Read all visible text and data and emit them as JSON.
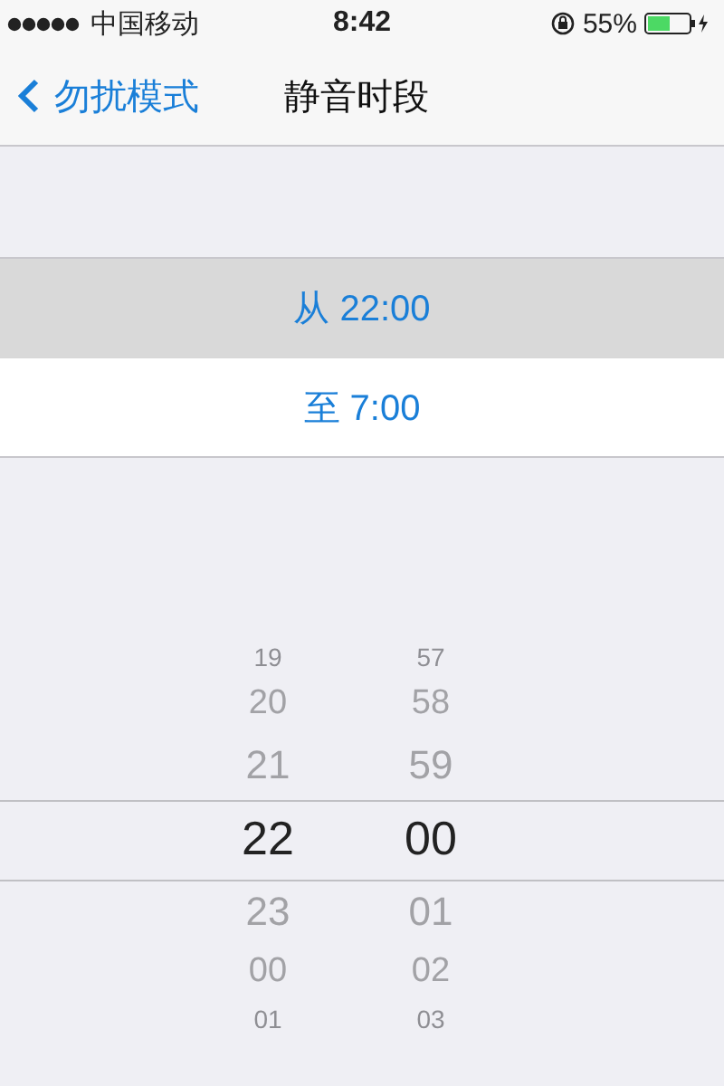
{
  "status_bar": {
    "carrier": "中国移动",
    "time": "8:42",
    "battery": "55%"
  },
  "nav_bar": {
    "back": "勿扰模式",
    "title": "静音时段"
  },
  "rows": [
    {
      "label": "从 22:00",
      "selected": true
    },
    {
      "label": "至 7:00",
      "selected": false
    }
  ],
  "picker": {
    "hours": [
      {
        "value": "19",
        "selected": false
      },
      {
        "value": "20",
        "selected": false
      },
      {
        "value": "21",
        "selected": false
      },
      {
        "value": "22",
        "selected": true
      },
      {
        "value": "23",
        "selected": false
      },
      {
        "value": "00",
        "selected": false
      },
      {
        "value": "01",
        "selected": false
      }
    ],
    "minutes": [
      {
        "value": "57",
        "selected": false
      },
      {
        "value": "58",
        "selected": false
      },
      {
        "value": "59",
        "selected": false
      },
      {
        "value": "00",
        "selected": true
      },
      {
        "value": "01",
        "selected": false
      },
      {
        "value": "02",
        "selected": false
      },
      {
        "value": "03",
        "selected": false
      }
    ]
  }
}
